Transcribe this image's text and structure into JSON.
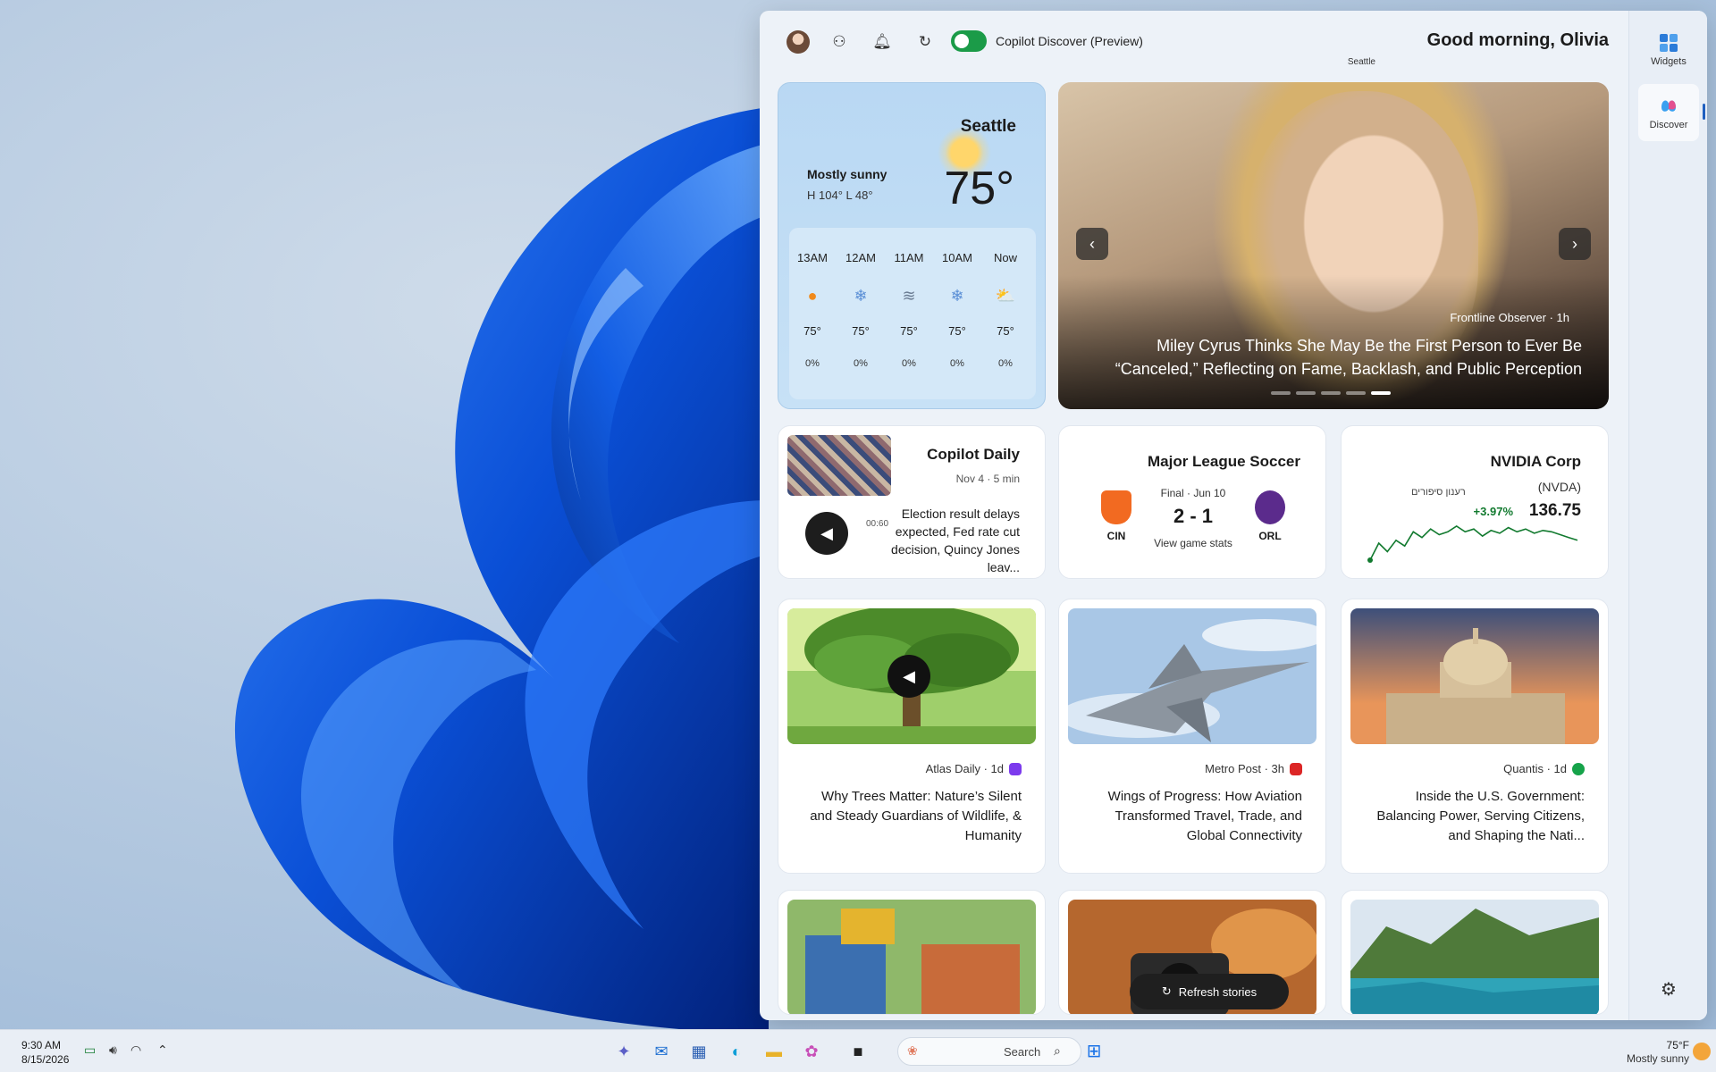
{
  "panel": {
    "greeting": "Good morning, Olivia",
    "city_small": "Seattle",
    "toggle_label": "Copilot Discover (Preview)",
    "toggle_on": true
  },
  "rail": {
    "items": [
      {
        "label": "Widgets"
      },
      {
        "label": "Discover"
      }
    ]
  },
  "weather": {
    "city": "Seattle",
    "temp": "75°",
    "condition": "Mostly sunny",
    "high_low": "H 104°  L 48°",
    "forecast": [
      {
        "time": "Now",
        "icon": "partly-sunny-icon",
        "glyph": "⛅",
        "temp": "75°",
        "precip": "0%"
      },
      {
        "time": "10AM",
        "icon": "snow-cloud-icon",
        "glyph": "❄",
        "temp": "75°",
        "precip": "0%"
      },
      {
        "time": "11AM",
        "icon": "wind-icon",
        "glyph": "≋",
        "temp": "75°",
        "precip": "0%"
      },
      {
        "time": "12AM",
        "icon": "snow-cloud-icon",
        "glyph": "❄",
        "temp": "75°",
        "precip": "0%"
      },
      {
        "time": "13AM",
        "icon": "sun-icon",
        "glyph": "●",
        "temp": "75°",
        "precip": "0%"
      }
    ]
  },
  "hero": {
    "source": "Frontline Observer · 1h",
    "title": "Miley Cyrus Thinks She May Be the First Person to Ever Be “Canceled,” Reflecting on Fame, Backlash, and Public Perception",
    "slides": 5,
    "active_slide": 0
  },
  "copilot_daily": {
    "title": "Copilot Daily",
    "meta": "Nov 4 · 5 min",
    "text": "Election result delays expected, Fed rate cut decision, Quincy Jones leav...",
    "time": "00:60"
  },
  "soccer": {
    "title": "Major League Soccer",
    "status": "Final · Jun 10",
    "score": "2 - 1",
    "link": "View game stats",
    "home": "ORL",
    "away": "CIN",
    "home_color": "#5b2b8c",
    "away_color": "#f26a21"
  },
  "stock": {
    "title": "NVIDIA Corp",
    "ticker": "(NVDA)",
    "price": "136.75",
    "change": "+3.97%",
    "label": "רענון סיפורים",
    "points": [
      50,
      38,
      44,
      36,
      40,
      30,
      34,
      28,
      32,
      30,
      26,
      30,
      28,
      33,
      29,
      31,
      27,
      30,
      28,
      31,
      29,
      30,
      32,
      34,
      36
    ]
  },
  "news": [
    {
      "source": "Quantis · 1d",
      "title": "Inside the U.S. Government: Balancing Power, Serving Citizens, and Shaping the Nati...",
      "badge_color": "#16a34a"
    },
    {
      "source": "Metro Post · 3h",
      "title": "Wings of Progress: How Aviation Transformed Travel, Trade, and Global Connectivity",
      "badge_color": "#dc2626"
    },
    {
      "source": "Atlas Daily · 1d",
      "title": "Why Trees Matter: Nature’s Silent and Steady Guardians of Wildlife, & Humanity",
      "badge_color": "#7c3aed"
    }
  ],
  "refresh_label": "Refresh stories",
  "taskbar": {
    "weather_temp": "75°F",
    "weather_cond": "Mostly sunny",
    "search_placeholder": "Search",
    "time": "9:30 AM",
    "date": "8/15/2026"
  }
}
